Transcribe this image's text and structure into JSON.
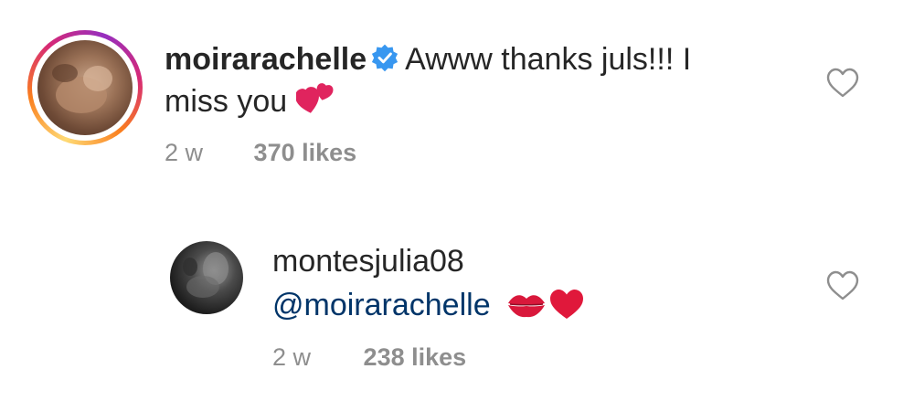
{
  "comments": [
    {
      "username": "moirarachelle",
      "verified": true,
      "text_line1": "Awww thanks juls!!! I",
      "text_line2": "miss you",
      "emoji": "two-hearts",
      "time": "2 w",
      "likes": "370 likes"
    },
    {
      "username": "montesjulia08",
      "mention": "@moirarachelle",
      "emojis": [
        "kiss-mark",
        "red-heart"
      ],
      "time": "2 w",
      "likes": "238 likes"
    }
  ],
  "colors": {
    "text": "#262626",
    "meta": "#8e8e8e",
    "mention": "#003569",
    "verified": "#3897f0",
    "emoji_red": "#e0245e"
  }
}
